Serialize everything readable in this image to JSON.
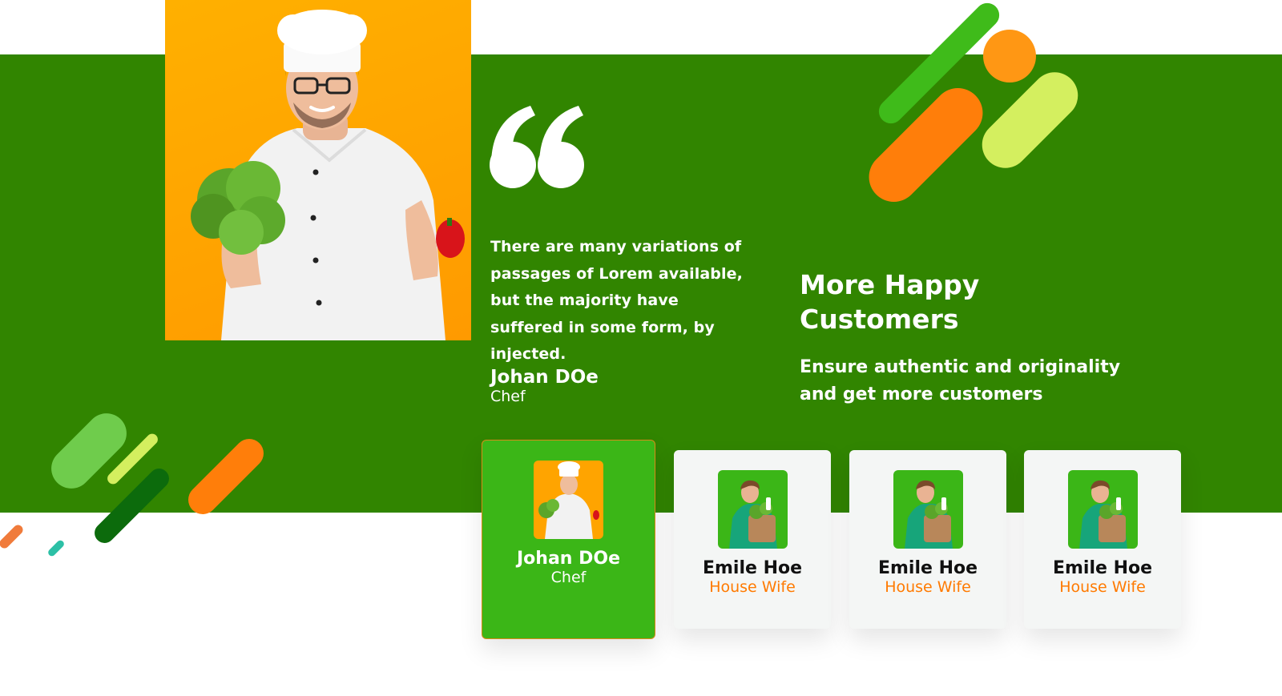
{
  "testimonial": {
    "quote": "There are many variations of passages of Lorem  available, but the majority have suffered in some form, by injected.",
    "author_name": "Johan DOe",
    "author_role": "Chef"
  },
  "section": {
    "heading": "More Happy Customers",
    "subheading": "Ensure authentic and originality and get more customers"
  },
  "customers": [
    {
      "name": "Johan DOe",
      "role": "Chef",
      "active": true
    },
    {
      "name": "Emile Hoe",
      "role": "House Wife",
      "active": false
    },
    {
      "name": "Emile Hoe",
      "role": "House Wife",
      "active": false
    },
    {
      "name": "Emile Hoe",
      "role": "House Wife",
      "active": false
    }
  ],
  "colors": {
    "band_green": "#318500",
    "active_card": "#3bb617",
    "accent_orange": "#ff7a00",
    "photo_orange": "#ffa400",
    "lime": "#d4ef5f"
  },
  "icons": [
    "quote-icon"
  ]
}
